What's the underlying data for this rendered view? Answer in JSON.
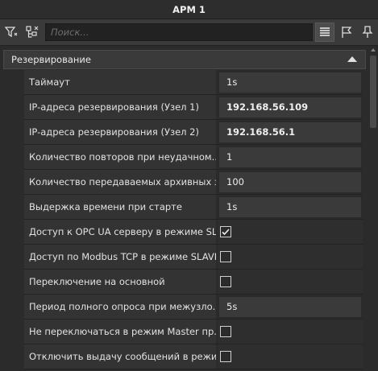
{
  "window": {
    "title": "АРМ 1"
  },
  "toolbar": {
    "search_placeholder": "Поиск...",
    "icons": [
      "filter-icon",
      "tree-expand-icon",
      "list-view-icon",
      "flag-icon",
      "pin-icon"
    ]
  },
  "section": {
    "title": "Резервирование",
    "expanded": true
  },
  "rows": [
    {
      "label": "Таймаут",
      "type": "text",
      "value": "1s",
      "bold": false
    },
    {
      "label": "IP-адреса резервирования (Узел 1)",
      "type": "text",
      "value": "192.168.56.109",
      "bold": true
    },
    {
      "label": "IP-адреса резервирования (Узел 2)",
      "type": "text",
      "value": "192.168.56.1",
      "bold": true
    },
    {
      "label": "Количество повторов при неудачном...",
      "type": "text",
      "value": "1",
      "bold": false
    },
    {
      "label": "Количество передаваемых архивных з...",
      "type": "text",
      "value": "100",
      "bold": false
    },
    {
      "label": "Выдержка времени при старте",
      "type": "text",
      "value": "1s",
      "bold": false
    },
    {
      "label": "Доступ к OPC UA серверу в режиме SL...",
      "type": "checkbox",
      "checked": true
    },
    {
      "label": "Доступ по Modbus TCP в режиме SLAVE",
      "type": "checkbox",
      "checked": false
    },
    {
      "label": "Переключение на основной",
      "type": "checkbox",
      "checked": false
    },
    {
      "label": "Период полного опроса при межузло...",
      "type": "text",
      "value": "5s",
      "bold": false
    },
    {
      "label": "Не переключаться в режим Master пр...",
      "type": "checkbox",
      "checked": false
    },
    {
      "label": "Отключить выдачу сообщений в режи...",
      "type": "checkbox",
      "checked": false
    }
  ]
}
